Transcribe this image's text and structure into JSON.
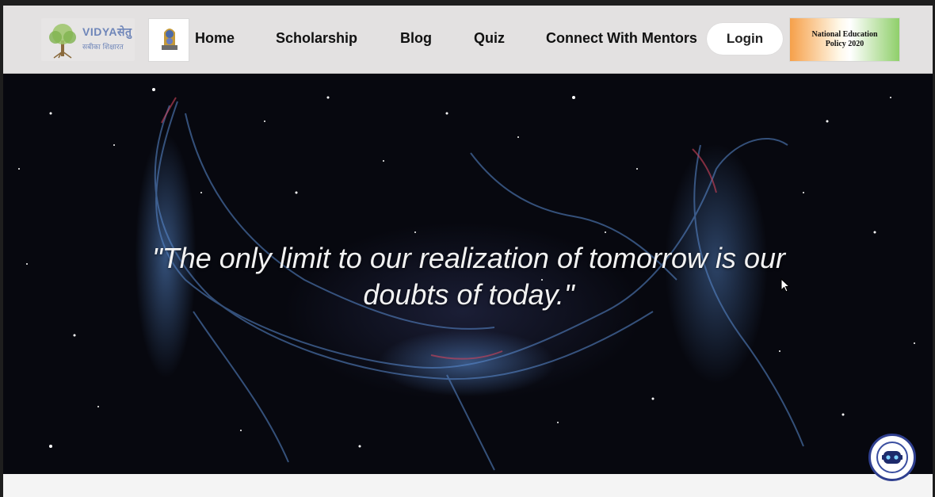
{
  "brand": {
    "name": "VIDYAसेतु",
    "tagline": "सबीका शिक्षारत"
  },
  "nav": {
    "home": "Home",
    "scholarship": "Scholarship",
    "blog": "Blog",
    "quiz": "Quiz",
    "mentors": "Connect With Mentors",
    "login": "Login"
  },
  "nep_badge": {
    "line1": "National Education",
    "line2": "Policy 2020"
  },
  "hero": {
    "quote_line1": "\"The only limit to our realization of tomorrow is our",
    "quote_line2": "doubts of today.\""
  },
  "icons": {
    "brand": "tree-logo-icon",
    "emblem": "national-emblem-icon",
    "chatbot": "chatbot-robot-icon",
    "cursor": "mouse-cursor-icon"
  },
  "colors": {
    "navbar_bg": "#e3e1e1",
    "hero_bg": "#07080f",
    "nebula_blue": "#5a8cd2",
    "chatbot_border": "#2f3f8f"
  }
}
